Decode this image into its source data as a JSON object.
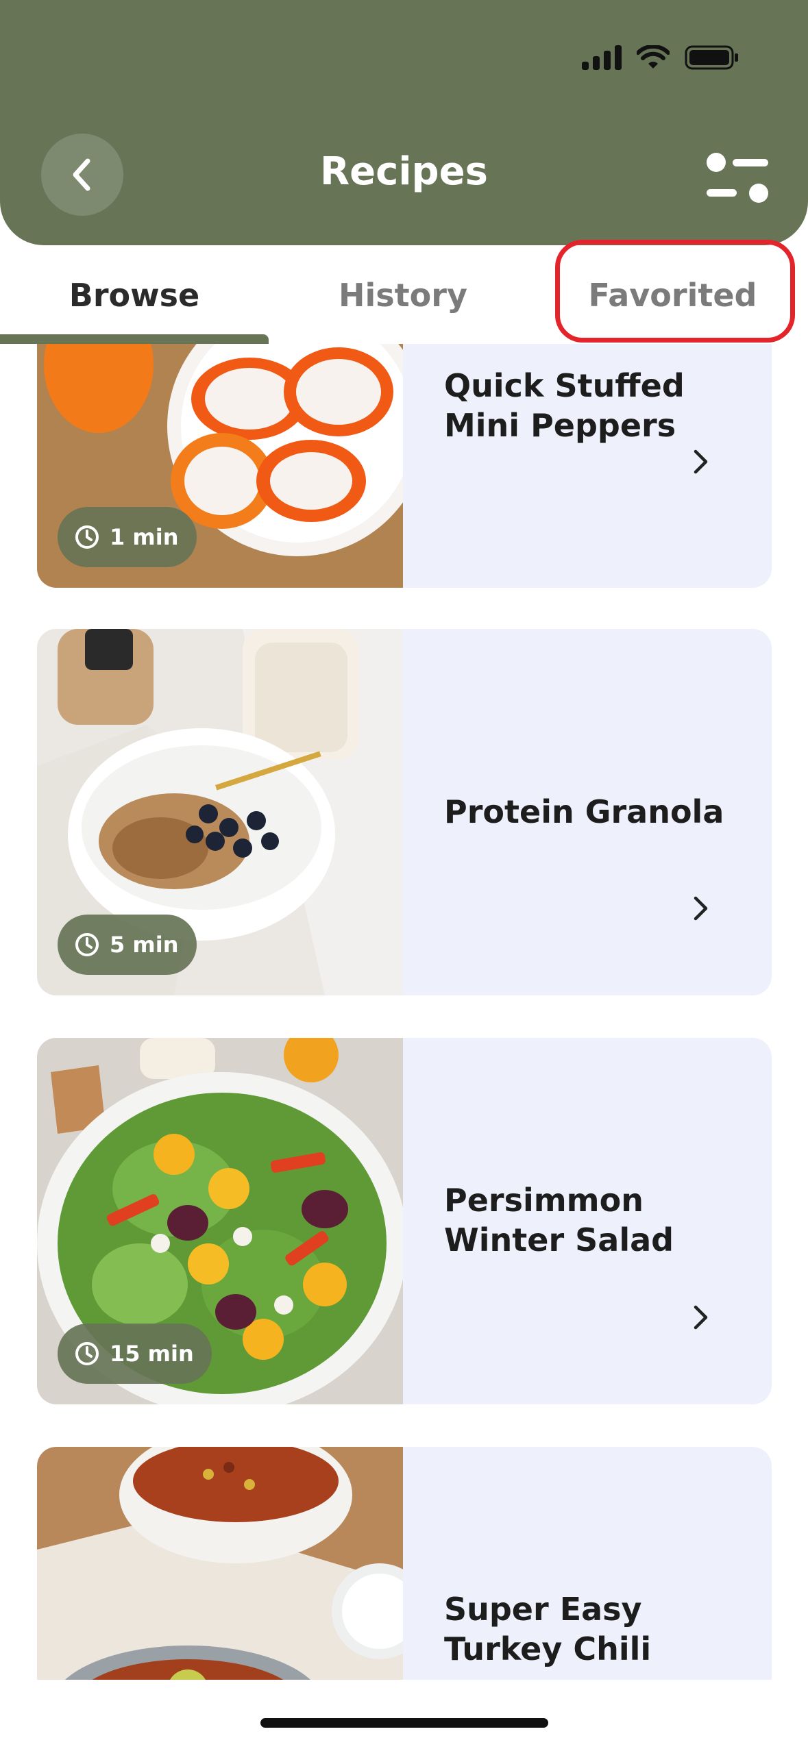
{
  "header": {
    "title": "Recipes"
  },
  "tabs": [
    {
      "label": "Browse"
    },
    {
      "label": "History"
    },
    {
      "label": "Favorited"
    }
  ],
  "recipes": [
    {
      "title": "Quick Stuffed Mini Peppers",
      "time": "1 min"
    },
    {
      "title": "Protein Granola",
      "time": "5 min"
    },
    {
      "title": "Persimmon Winter Salad",
      "time": "15 min"
    },
    {
      "title": "Super Easy Turkey Chili",
      "time": ""
    }
  ],
  "icons": {
    "back": "chevron-left-icon",
    "filter": "filter-toggle-icon",
    "clock": "clock-icon",
    "chevron": "chevron-right-icon"
  },
  "colors": {
    "header": "#677456",
    "card_bg": "#eef1fb",
    "highlight": "#e3242b"
  }
}
